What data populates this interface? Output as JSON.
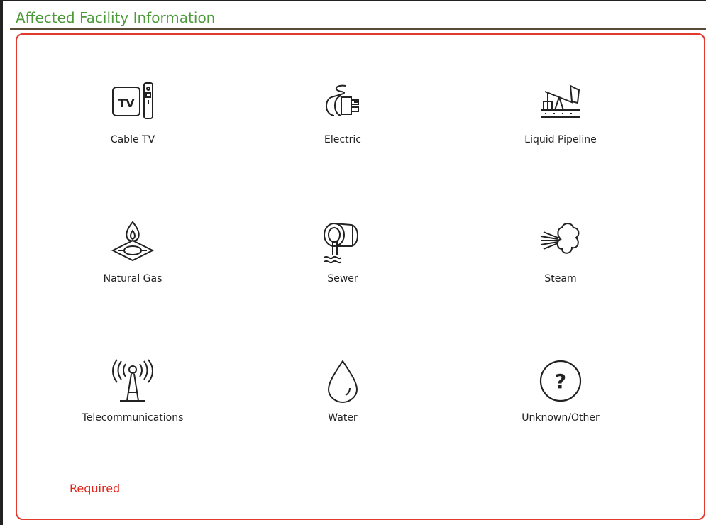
{
  "section": {
    "title": "Affected Facility Information",
    "required_text": "Required"
  },
  "options": [
    {
      "label": "Cable TV",
      "icon": "cable-tv-icon"
    },
    {
      "label": "Electric",
      "icon": "electric-plug-icon"
    },
    {
      "label": "Liquid Pipeline",
      "icon": "pumpjack-icon"
    },
    {
      "label": "Natural Gas",
      "icon": "gas-flame-icon"
    },
    {
      "label": "Sewer",
      "icon": "sewer-pipe-icon"
    },
    {
      "label": "Steam",
      "icon": "steam-icon"
    },
    {
      "label": "Telecommunications",
      "icon": "antenna-tower-icon"
    },
    {
      "label": "Water",
      "icon": "water-drop-icon"
    },
    {
      "label": "Unknown/Other",
      "icon": "question-circle-icon"
    }
  ],
  "colors": {
    "header_green": "#4c9a3a",
    "panel_border_red": "#e23a2f",
    "required_red": "#e2231a"
  }
}
